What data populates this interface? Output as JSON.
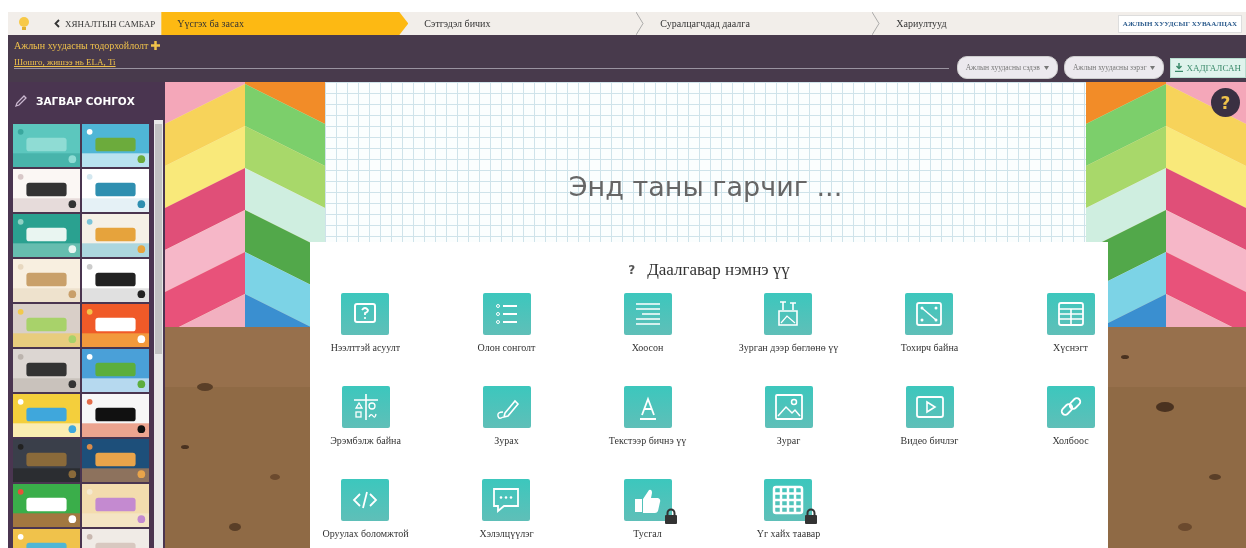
{
  "nav": {
    "back_link": "ХЯНАЛТЫН САМБАР",
    "steps": [
      {
        "label": "Үүсгэх ба засах",
        "selected": true
      },
      {
        "label": "Сэтгэдэл бичих",
        "selected": false
      },
      {
        "label": "Суралцагчдад даалга",
        "selected": false
      },
      {
        "label": "Хариултууд",
        "selected": false
      }
    ],
    "share_button": "АЖЛЫН ХУУДСЫГ ХУВААЛЦАХ"
  },
  "header": {
    "title": "Ажлын хуудасны тодорхойлолт",
    "tags_field": {
      "placeholder": "Шошго, жишээ нь ELA, Ti"
    },
    "dropdowns": [
      "Ажлын хуудасны сэдэв",
      "Ажлын хуудасны зэрэг"
    ],
    "save_button": "ХАДГАЛСАН"
  },
  "sidebar": {
    "title": "ЗАГВАР СОНГОХ"
  },
  "canvas": {
    "title": "Энд таны гарчиг ...",
    "help_button": "?"
  },
  "add_task_panel": {
    "icon": "?",
    "title": "Даалгавар нэмнэ үү",
    "tasks": [
      {
        "label": "Нээлттэй асуулт",
        "locked": false
      },
      {
        "label": "Олон сонголт",
        "locked": false
      },
      {
        "label": "Хоосон",
        "locked": false
      },
      {
        "label": "Зурган дээр бөглөнө үү",
        "locked": false
      },
      {
        "label": "Тохирч байна",
        "locked": false
      },
      {
        "label": "Хүснэгт",
        "locked": false
      },
      {
        "label": "Эрэмбэлж байна",
        "locked": false
      },
      {
        "label": "Зурах",
        "locked": false
      },
      {
        "label": "Текстээр бичнэ үү",
        "locked": false
      },
      {
        "label": "Зураг",
        "locked": false
      },
      {
        "label": "Видео бичлэг",
        "locked": false
      },
      {
        "label": "Холбоос",
        "locked": false
      },
      {
        "label": "Оруулах боломжтой",
        "locked": false
      },
      {
        "label": "Хэлэлцүүлэг",
        "locked": false
      },
      {
        "label": "Тусгал",
        "locked": true
      },
      {
        "label": "Үг хайх таавар",
        "locked": true
      }
    ]
  }
}
